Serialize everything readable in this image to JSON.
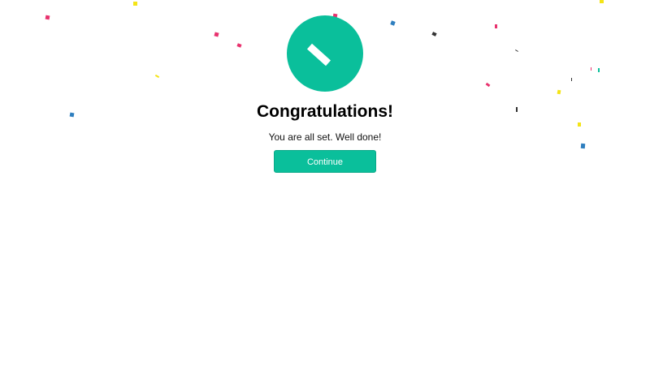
{
  "dialog": {
    "title": "Congratulations!",
    "message": "You are all set. Well done!",
    "continue_label": "Continue"
  },
  "colors": {
    "accent": "#0abf9b",
    "background": "#ffffff",
    "confetti": [
      "#e8326e",
      "#f4e417",
      "#2f7fbf",
      "#333333",
      "#0abf9b"
    ]
  },
  "icons": {
    "success": "check-icon",
    "decoration": "confetti"
  }
}
